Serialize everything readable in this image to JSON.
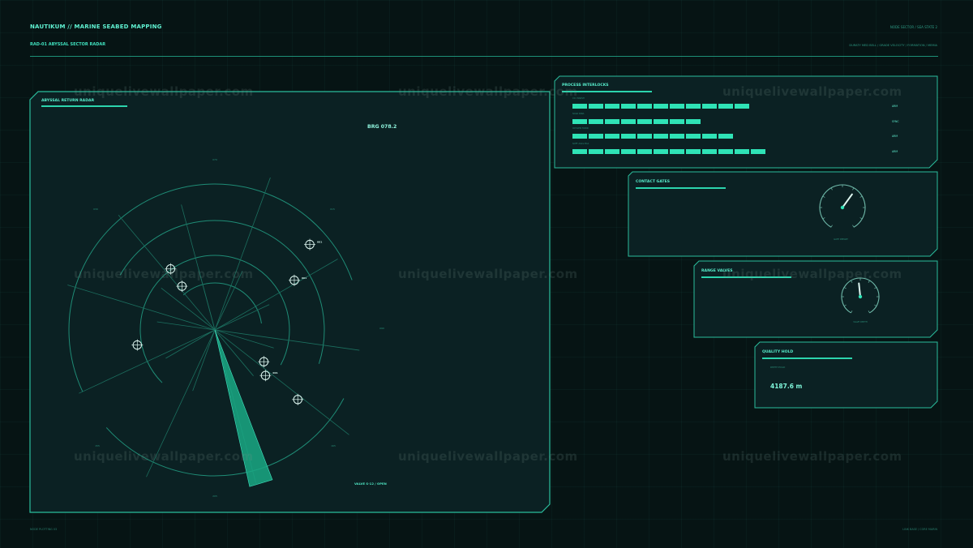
{
  "header": {
    "title": "NAUTIKUM // MARINE SEABED MAPPING",
    "subtitle": "RAD-01 ABYSSAL SECTOR RADAR",
    "right_top": "NODE SECTOR / SEA STATE 2",
    "right_sub": "DURATY MED BELL / GRADE VELOCITY / FORMATION / MEMIA"
  },
  "watermark": "uniquelivewallpaper.com",
  "radar_panel": {
    "title": "ABYSSAL RETURN RADAR",
    "bearing": "BRG 078.2",
    "valve": "VALVE S-12 / OPEN",
    "ring_labels": [
      "070",
      "030",
      "015",
      "090",
      "155",
      "165",
      "205",
      "220"
    ],
    "contacts": [
      {
        "id": "c1",
        "label": "",
        "angle_deg": 324,
        "range": 0.62
      },
      {
        "id": "c2",
        "label": "",
        "angle_deg": 323,
        "range": 0.45
      },
      {
        "id": "c3",
        "label": "001",
        "angle_deg": 48,
        "range": 1.05
      },
      {
        "id": "c4",
        "label": "001",
        "angle_deg": 58,
        "range": 0.77
      },
      {
        "id": "c5",
        "label": "",
        "angle_deg": 259,
        "range": 0.65
      },
      {
        "id": "c6",
        "label": "",
        "angle_deg": 123,
        "range": 0.48
      },
      {
        "id": "c7",
        "label": "001",
        "angle_deg": 132,
        "range": 0.56
      },
      {
        "id": "c8",
        "label": "",
        "angle_deg": 130,
        "range": 0.89
      }
    ],
    "sweep_deg": 163
  },
  "interlocks": {
    "title": "PROCESS INTERLOCKS",
    "rows": [
      {
        "label": "CO. MARSH",
        "segments": 11,
        "tag": "ARM"
      },
      {
        "label": "SOLO DINA",
        "segments": 8,
        "tag": "SYNC"
      },
      {
        "label": "OXYGEN TOWR",
        "segments": 10,
        "tag": "ARM"
      },
      {
        "label": "SOFT ASCL ECA",
        "segments": 12,
        "tag": "ARM"
      }
    ]
  },
  "contact_gates": {
    "title": "CONTACT GATES",
    "gauge_caption": "GATE DEPART",
    "gauge_value": 0.62
  },
  "range_valves": {
    "title": "RANGE VALVES",
    "gauge_caption": "VALVE DEPTH",
    "gauge_value": 0.48
  },
  "quality_hold": {
    "title": "QUALITY HOLD",
    "label": "DEPTH HOLD",
    "value": "4187.6 m"
  },
  "footer": {
    "left": "NODE PLOTTING 03",
    "right": "LINK BASE / CORE MARIN"
  },
  "colors": {
    "accent": "#2fe3b6",
    "border": "#2bbd9c",
    "bg": "#061414",
    "panel_bg": "#0b2123"
  }
}
